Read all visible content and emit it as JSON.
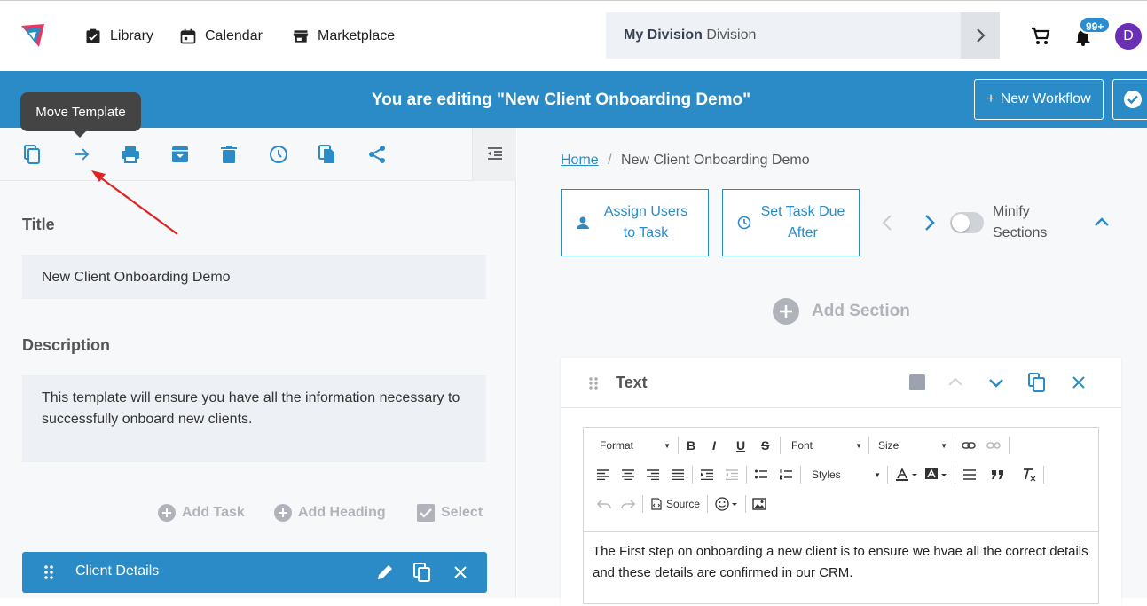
{
  "nav": {
    "library": "Library",
    "calendar": "Calendar",
    "marketplace": "Marketplace",
    "division_bold": "My Division",
    "division_rest": "Division",
    "notification_count": "99+",
    "avatar_letter": "D"
  },
  "banner": {
    "title": "You are editing \"New Client Onboarding Demo\"",
    "new_workflow": "New Workflow",
    "plus": "+"
  },
  "tooltip": "Move Template",
  "left": {
    "title_label": "Title",
    "title_value": "New Client Onboarding Demo",
    "description_label": "Description",
    "description_value": "This template will ensure you have all the information necessary to successfully onboard new clients.",
    "add_task": "Add Task",
    "add_heading": "Add Heading",
    "select": "Select",
    "section_name": "Client Details"
  },
  "right": {
    "breadcrumb_home": "Home",
    "breadcrumb_sep": "/",
    "breadcrumb_current": "New Client Onboarding Demo",
    "assign_users": "Assign Users to Task",
    "set_due": "Set Task Due After",
    "minify": "Minify Sections",
    "add_section": "Add Section",
    "card_title": "Text",
    "editor": {
      "format": "Format",
      "font": "Font",
      "size": "Size",
      "styles": "Styles",
      "source": "Source",
      "bold": "B",
      "italic": "I",
      "underline": "U",
      "strike": "S",
      "content": "The First step on onboarding a new client is to ensure we hvae all the correct details and these details are confirmed in our CRM."
    }
  },
  "colors": {
    "primary": "#2a8bc6",
    "avatar": "#6a2fb4",
    "annotation_arrow": "#e02424"
  }
}
